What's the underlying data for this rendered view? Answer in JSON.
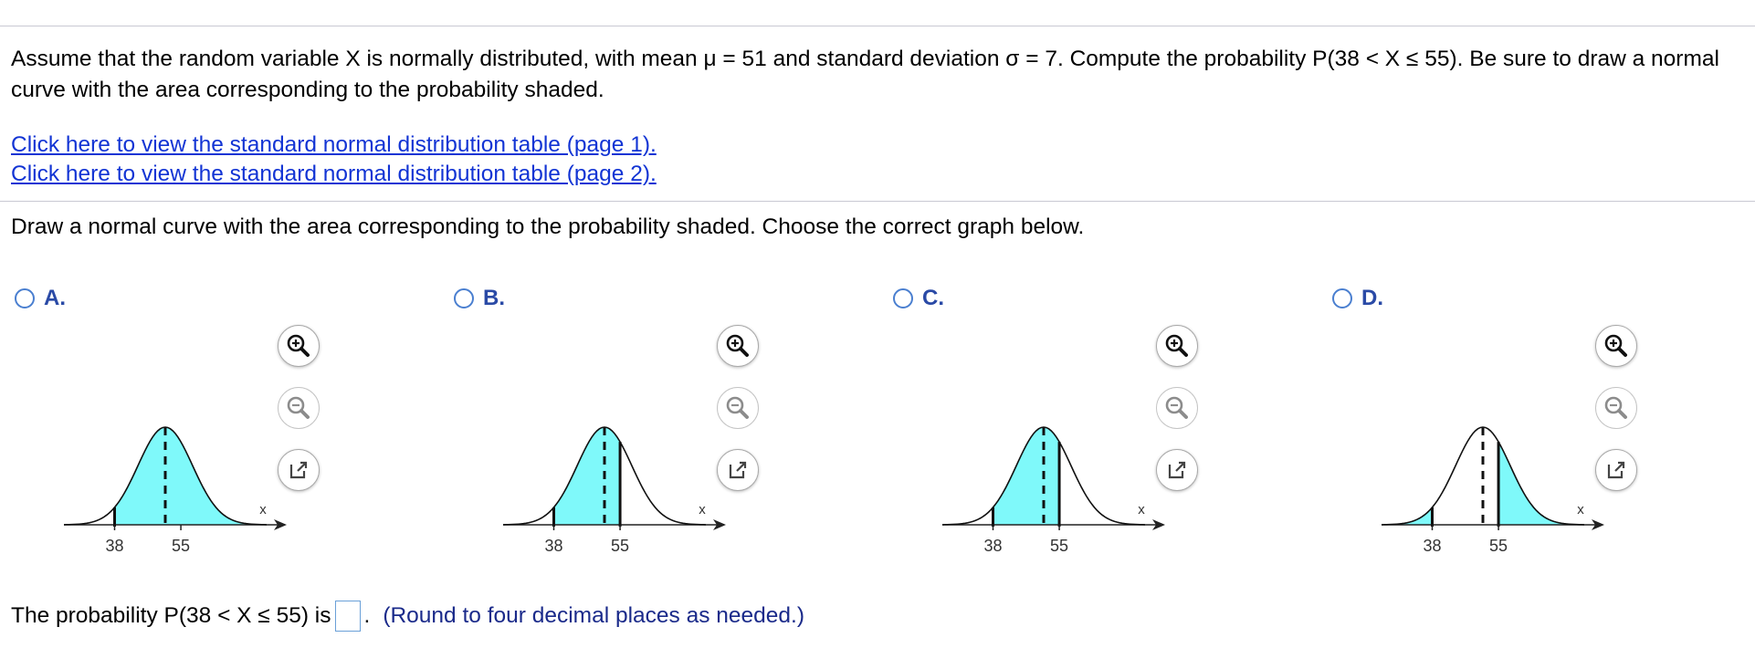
{
  "question": {
    "text": "Assume that the random variable X is normally distributed, with mean μ = 51 and standard deviation σ = 7. Compute the probability P(38 < X ≤ 55). Be sure to draw a normal curve with the area corresponding to the probability shaded."
  },
  "links": [
    "Click here to view the standard normal distribution table (page 1).",
    "Click here to view the standard normal distribution table (page 2)."
  ],
  "instruction": "Draw a normal curve with the area corresponding to the probability shaded. Choose the correct graph below.",
  "options": [
    {
      "letter": "A.",
      "tick_low": "38",
      "tick_high": "55",
      "axis_label": "x",
      "shade": "full"
    },
    {
      "letter": "B.",
      "tick_low": "38",
      "tick_high": "55",
      "axis_label": "x",
      "shade": "mu-to-high"
    },
    {
      "letter": "C.",
      "tick_low": "38",
      "tick_high": "55",
      "axis_label": "x",
      "shade": "left-to-high"
    },
    {
      "letter": "D.",
      "tick_low": "38",
      "tick_high": "55",
      "axis_label": "x",
      "shade": "tails"
    }
  ],
  "answer": {
    "prefix": "The probability P(38 < X ≤ 55) is",
    "suffix": ".",
    "hint": "(Round to four decimal places as needed.)",
    "value": ""
  },
  "colors": {
    "shade": "#7ff9fa",
    "link": "#1234d4",
    "option_label": "#2a4aa6"
  },
  "icons": {
    "zoom_in": "zoom-in-icon",
    "zoom_out": "zoom-out-icon",
    "popout": "popout-icon"
  }
}
